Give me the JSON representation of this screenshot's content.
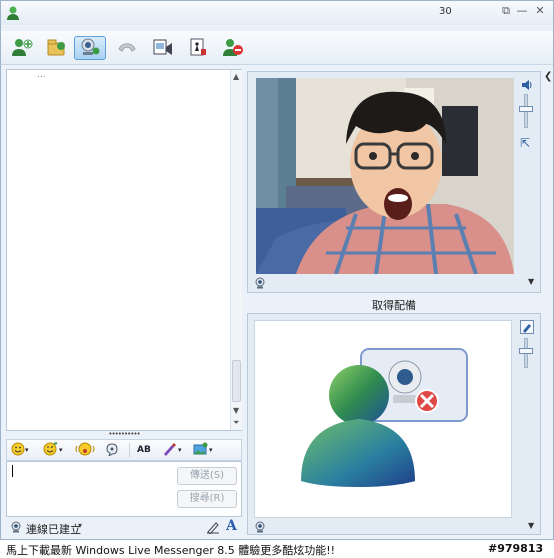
{
  "titlebar": {
    "title": "30",
    "icon": "messenger-buddy-icon",
    "controls": [
      "restore-icon",
      "minimize-icon",
      "close-icon"
    ]
  },
  "toolbar": {
    "items": [
      {
        "icon": "invite-contact-icon"
      },
      {
        "icon": "send-files-icon"
      },
      {
        "icon": "video-call-icon",
        "active": true
      },
      {
        "icon": "voice-call-icon",
        "disabled": true
      },
      {
        "icon": "share-activities-icon"
      },
      {
        "icon": "games-icon"
      },
      {
        "icon": "block-contact-icon"
      }
    ]
  },
  "history": {
    "dots": "..."
  },
  "splitter": {
    "dots": "••••••••••"
  },
  "format_bar": {
    "font_label": "AB"
  },
  "compose": {
    "send_label": "傳送(S)",
    "search_label": "搜尋(R)"
  },
  "status": {
    "text": "連線已建立"
  },
  "video": {
    "remote_label": "取得配備"
  },
  "ad": {
    "text": "馬上下載最新 Windows Live Messenger 8.5 體驗更多酷炫功能!!"
  },
  "watermark": {
    "text": "#979813"
  },
  "colors": {
    "accent": "#5f9fd8",
    "frame": "#eaf1f8",
    "border": "#b9c9d9"
  }
}
